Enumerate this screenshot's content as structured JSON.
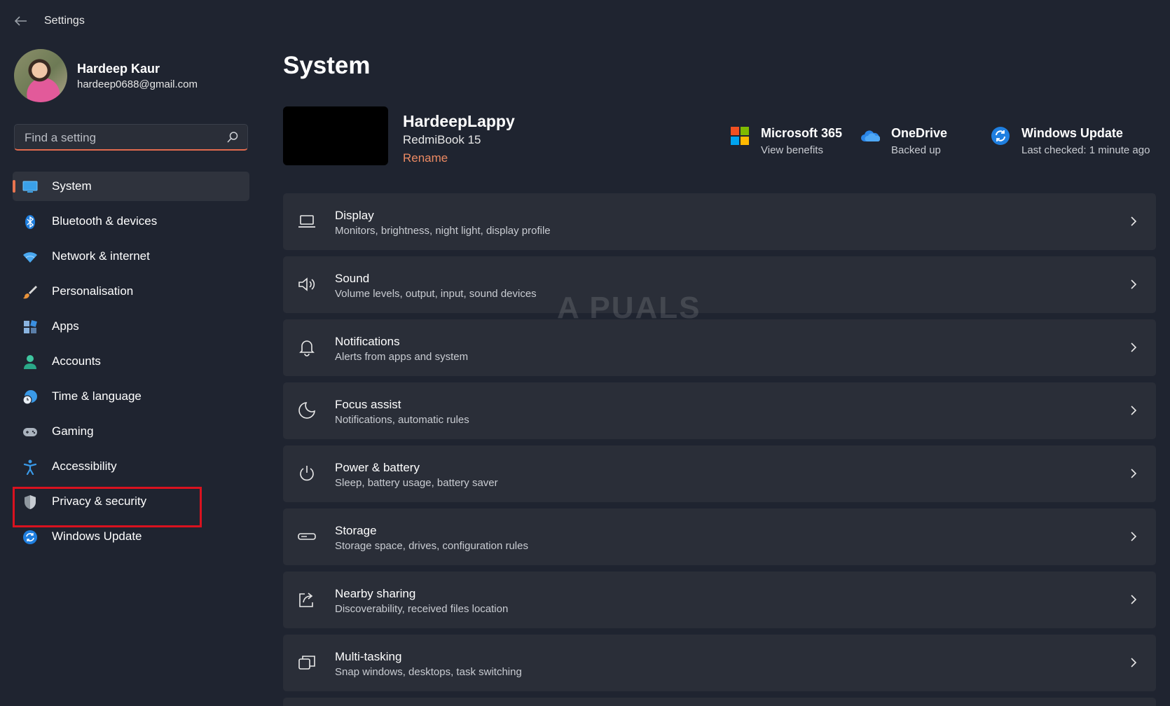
{
  "window": {
    "title": "Settings"
  },
  "profile": {
    "name": "Hardeep Kaur",
    "email": "hardeep0688@gmail.com"
  },
  "search": {
    "placeholder": "Find a setting",
    "value": ""
  },
  "sidebar": {
    "items": [
      {
        "label": "System",
        "icon": "system-monitor-icon",
        "active": true
      },
      {
        "label": "Bluetooth & devices",
        "icon": "bluetooth-icon"
      },
      {
        "label": "Network & internet",
        "icon": "wifi-icon"
      },
      {
        "label": "Personalisation",
        "icon": "paintbrush-icon"
      },
      {
        "label": "Apps",
        "icon": "apps-icon"
      },
      {
        "label": "Accounts",
        "icon": "accounts-icon"
      },
      {
        "label": "Time & language",
        "icon": "globe-clock-icon"
      },
      {
        "label": "Gaming",
        "icon": "gamepad-icon"
      },
      {
        "label": "Accessibility",
        "icon": "accessibility-icon"
      },
      {
        "label": "Privacy & security",
        "icon": "shield-icon",
        "highlighted": true
      },
      {
        "label": "Windows Update",
        "icon": "update-icon"
      }
    ]
  },
  "main": {
    "title": "System",
    "device": {
      "name": "HardeepLappy",
      "model": "RedmiBook 15",
      "rename_label": "Rename"
    },
    "tiles": [
      {
        "title": "Microsoft 365",
        "subtitle": "View benefits",
        "icon": "microsoft-logo-icon"
      },
      {
        "title": "OneDrive",
        "subtitle": "Backed up",
        "icon": "onedrive-cloud-icon"
      },
      {
        "title": "Windows Update",
        "subtitle": "Last checked: 1 minute ago",
        "icon": "update-icon"
      }
    ],
    "cards": [
      {
        "title": "Display",
        "subtitle": "Monitors, brightness, night light, display profile",
        "icon": "laptop-icon"
      },
      {
        "title": "Sound",
        "subtitle": "Volume levels, output, input, sound devices",
        "icon": "speaker-icon"
      },
      {
        "title": "Notifications",
        "subtitle": "Alerts from apps and system",
        "icon": "bell-icon"
      },
      {
        "title": "Focus assist",
        "subtitle": "Notifications, automatic rules",
        "icon": "moon-icon"
      },
      {
        "title": "Power & battery",
        "subtitle": "Sleep, battery usage, battery saver",
        "icon": "power-icon"
      },
      {
        "title": "Storage",
        "subtitle": "Storage space, drives, configuration rules",
        "icon": "storage-drive-icon"
      },
      {
        "title": "Nearby sharing",
        "subtitle": "Discoverability, received files location",
        "icon": "share-icon"
      },
      {
        "title": "Multi-tasking",
        "subtitle": "Snap windows, desktops, task switching",
        "icon": "multitask-icon"
      }
    ]
  },
  "watermark": {
    "text": "A PUALS"
  },
  "colors": {
    "accent": "#e8744f",
    "highlight_box": "#d9121f",
    "background": "#1f2430",
    "card": "#2a2e38"
  }
}
